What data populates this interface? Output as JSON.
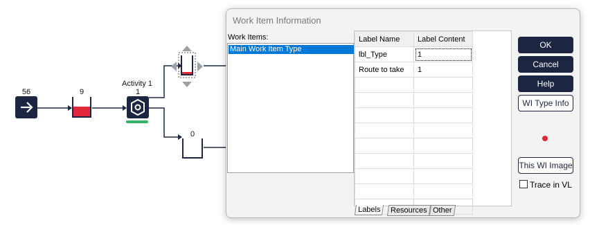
{
  "canvas": {
    "start_node": {
      "count": "56",
      "icon": "arrow-right-icon"
    },
    "queue1": {
      "count": "9",
      "fill_level": 0.45,
      "fill_color": "#e0283a"
    },
    "activity": {
      "title": "Activity 1",
      "count": "1",
      "icon": "gear-icon",
      "status_color": "#36b36a"
    },
    "queue_top": {
      "fill_level": 0.15,
      "fill_color": "#e0283a"
    },
    "queue_bottom": {
      "count": "0"
    }
  },
  "dialog": {
    "title": "Work Item Information",
    "work_items_label": "Work Items:",
    "work_items": [
      "Main Work Item Type"
    ],
    "grid": {
      "headers": [
        "Label Name",
        "Label Content"
      ],
      "rows": [
        [
          "lbl_Type",
          "1"
        ],
        [
          "Route to take",
          "1"
        ]
      ]
    },
    "tabs": [
      "Labels",
      "Resources",
      "Other"
    ],
    "active_tab": "Labels",
    "buttons": {
      "ok": "OK",
      "cancel": "Cancel",
      "help": "Help",
      "wi_type_info": "WI Type Info",
      "this_wi_image": "This WI Image"
    },
    "trace_label": "Trace in VL",
    "trace_checked": false,
    "indicator_color": "#e0283a"
  }
}
